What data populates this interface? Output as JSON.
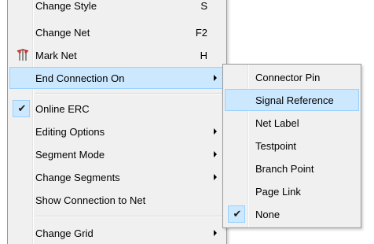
{
  "menu": {
    "items": [
      {
        "label": "Change Style",
        "accel": "S"
      },
      {
        "label": "Change Net",
        "accel": "F2"
      },
      {
        "label": "Mark Net",
        "accel": "H",
        "icon": "mark-net-icon"
      },
      {
        "label": "End Connection On",
        "submenu": true,
        "highlighted": true
      },
      {
        "label": "Online ERC",
        "checked": true
      },
      {
        "label": "Editing Options",
        "submenu": true
      },
      {
        "label": "Segment Mode",
        "submenu": true
      },
      {
        "label": "Change Segments",
        "submenu": true
      },
      {
        "label": "Show Connection to Net"
      },
      {
        "label": "Change Grid",
        "submenu": true
      }
    ]
  },
  "submenu": {
    "items": [
      {
        "label": "Connector Pin"
      },
      {
        "label": "Signal Reference",
        "highlighted": true
      },
      {
        "label": "Net Label"
      },
      {
        "label": "Testpoint"
      },
      {
        "label": "Branch Point"
      },
      {
        "label": "Page Link"
      },
      {
        "label": "None",
        "checked": true
      }
    ]
  },
  "colors": {
    "menu_bg": "#f0f0f0",
    "highlight_bg": "#cce8ff",
    "highlight_border": "#99d1ff",
    "border": "#979797"
  }
}
